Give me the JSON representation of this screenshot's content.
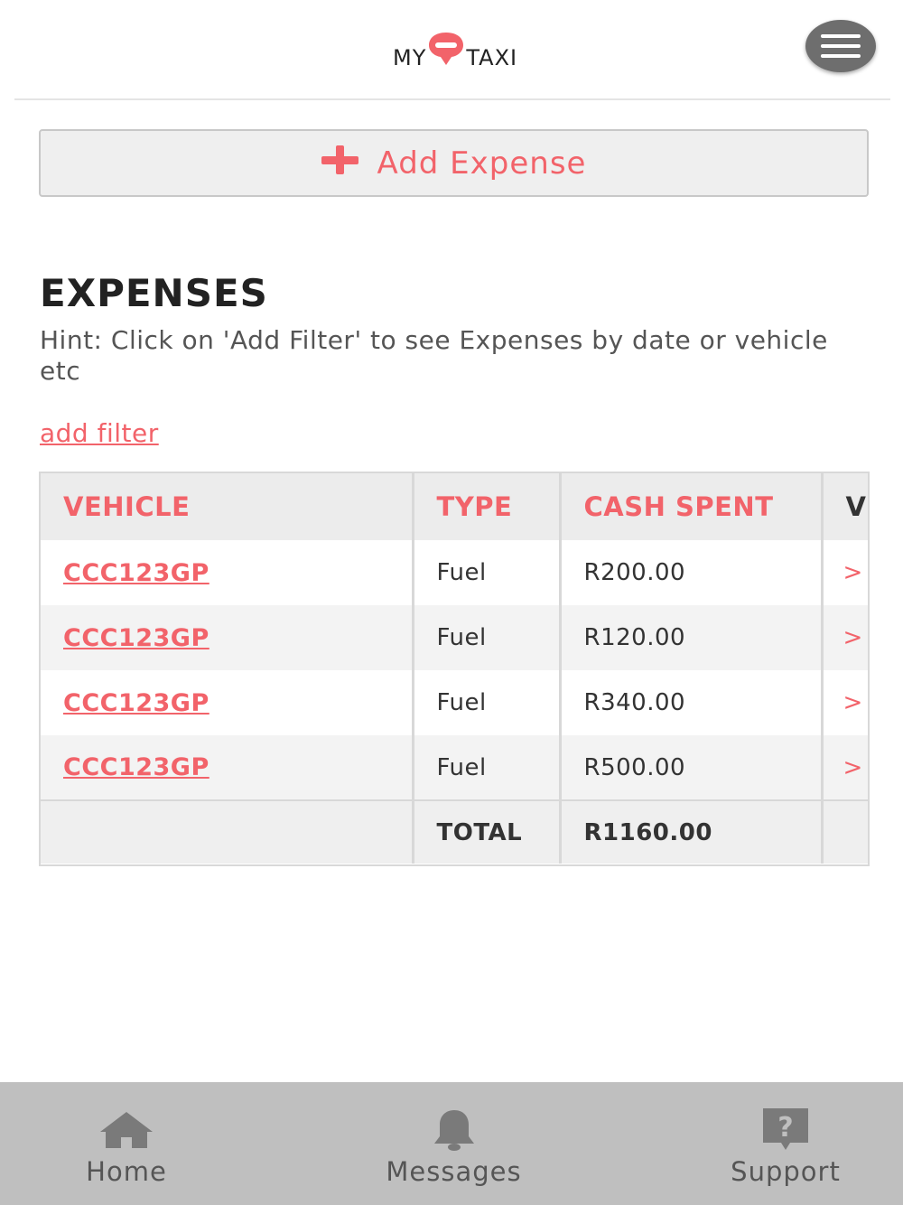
{
  "header": {
    "logo_left": "MY",
    "logo_right": "TAXI",
    "menu_icon": "hamburger-menu-icon"
  },
  "actions": {
    "add_expense_label": "Add Expense",
    "add_expense_icon": "plus-icon"
  },
  "expenses": {
    "title": "EXPENSES",
    "hint": "Hint: Click on 'Add Filter' to see Expenses by date or vehicle etc",
    "filter_link": "add filter",
    "columns": [
      "VEHICLE",
      "TYPE",
      "CASH SPENT",
      "V"
    ],
    "rows": [
      {
        "vehicle": "CCC123GP",
        "type": "Fuel",
        "cash": "R200.00",
        "chevron": ">"
      },
      {
        "vehicle": "CCC123GP",
        "type": "Fuel",
        "cash": "R120.00",
        "chevron": ">"
      },
      {
        "vehicle": "CCC123GP",
        "type": "Fuel",
        "cash": "R340.00",
        "chevron": ">"
      },
      {
        "vehicle": "CCC123GP",
        "type": "Fuel",
        "cash": "R500.00",
        "chevron": ">"
      }
    ],
    "total_label": "TOTAL",
    "total_value": "R1160.00"
  },
  "nav": {
    "items": [
      {
        "label": "Home",
        "icon": "home-icon"
      },
      {
        "label": "Messages",
        "icon": "bell-icon"
      },
      {
        "label": "Support",
        "icon": "question-icon"
      }
    ]
  },
  "colors": {
    "accent": "#f2636a",
    "nav_background": "#bfbfbf",
    "menu_button": "#6e6e6e"
  }
}
